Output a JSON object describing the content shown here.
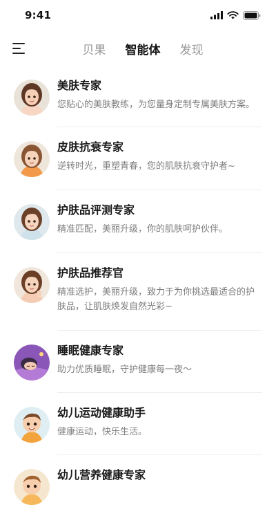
{
  "status_bar": {
    "time": "9:41"
  },
  "nav": {
    "tabs": [
      {
        "label": "贝果"
      },
      {
        "label": "智能体"
      },
      {
        "label": "发现"
      }
    ]
  },
  "agents": [
    {
      "name": "美肤专家",
      "description": "您贴心的美肤教练，为您量身定制专属美肤方案。",
      "avatar": "female-avatar"
    },
    {
      "name": "皮肤抗衰专家",
      "description": "逆转时光，重塑青春，您的肌肤抗衰守护者~",
      "avatar": "female-avatar"
    },
    {
      "name": "护肤品评测专家",
      "description": "精准匹配，美丽升级，你的肌肤呵护伙伴。",
      "avatar": "female-avatar"
    },
    {
      "name": "护肤品推荐官",
      "description": "精准选护，美丽升级，致力于为你挑选最适合的护肤品，让肌肤焕发自然光彩~",
      "avatar": "female-avatar"
    },
    {
      "name": "睡眠健康专家",
      "description": "助力优质睡眠，守护健康每一夜～",
      "avatar": "sleeping-avatar"
    },
    {
      "name": "幼儿运动健康助手",
      "description": "健康运动，快乐生活。",
      "avatar": "child-avatar"
    },
    {
      "name": "幼儿营养健康专家",
      "description": "",
      "avatar": "child-avatar"
    }
  ],
  "colors": {
    "active_tab": "#111111",
    "inactive_tab": "#9a9a9a",
    "description": "#7d7d7d",
    "divider": "#ededed"
  }
}
